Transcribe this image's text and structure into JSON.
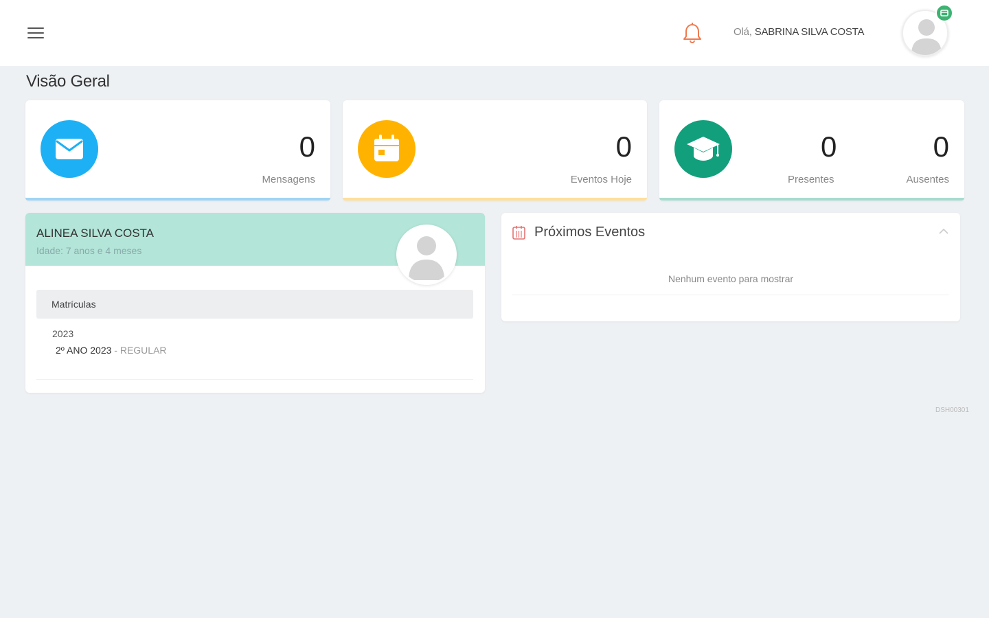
{
  "header": {
    "greeting_prefix": "Olá,",
    "user_name": "SABRINA SILVA COSTA"
  },
  "page": {
    "title": "Visão Geral"
  },
  "stats": {
    "messages": {
      "value": "0",
      "label": "Mensagens",
      "color": "#1eb0f5"
    },
    "events_today": {
      "value": "0",
      "label": "Eventos Hoje",
      "color": "#ffb300"
    },
    "attendance": {
      "present_value": "0",
      "present_label": "Presentes",
      "absent_value": "0",
      "absent_label": "Ausentes",
      "color": "#12a07c"
    }
  },
  "student": {
    "name": "ALINEA SILVA COSTA",
    "age": "Idade: 7 anos e 4 meses",
    "enrollments_title": "Matrículas",
    "year": "2023",
    "class_name": "2º ANO 2023",
    "class_type": " - REGULAR"
  },
  "events": {
    "title": "Próximos Eventos",
    "empty_text": "Nenhum evento para mostrar"
  },
  "footer": {
    "version": "DSH00301"
  },
  "colors": {
    "header_teal": "#b3e5d8",
    "bell_orange": "#f07a4f",
    "calendar_red": "#e57373",
    "badge_green": "#3cb371"
  }
}
